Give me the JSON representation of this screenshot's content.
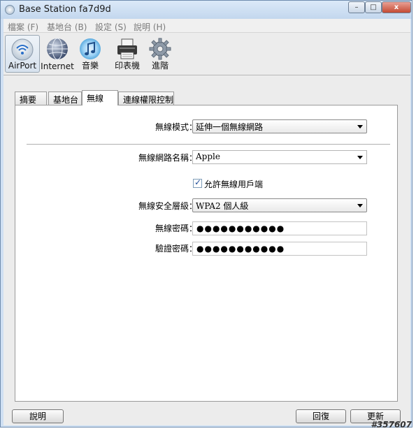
{
  "window": {
    "title": "Base Station fa7d9d"
  },
  "window_controls": {
    "minimize": "–",
    "maximize": "□",
    "close": "x"
  },
  "menu": [
    "檔案 (F)",
    "基地台 (B)",
    "設定 (S)",
    "說明 (H)"
  ],
  "toolbar": [
    {
      "label": "AirPort",
      "icon": "airport-icon",
      "selected": true
    },
    {
      "label": "Internet",
      "icon": "globe-icon",
      "selected": false
    },
    {
      "label": "音樂",
      "icon": "music-icon",
      "selected": false
    },
    {
      "label": "印表機",
      "icon": "printer-icon",
      "selected": false
    },
    {
      "label": "進階",
      "icon": "gear-icon",
      "selected": false
    }
  ],
  "tabs": [
    {
      "label": "摘要",
      "active": false
    },
    {
      "label": "基地台",
      "active": false
    },
    {
      "label": "無線",
      "active": true
    },
    {
      "label": "連線權限控制",
      "active": false
    }
  ],
  "form": {
    "wireless_mode_label": "無線模式：",
    "wireless_mode_value": "延伸一個無線網路",
    "network_name_label": "無線網路名稱：",
    "network_name_value": "Apple",
    "allow_clients_label": "允許無線用戶端",
    "allow_clients_checked": true,
    "security_label": "無線安全層級：",
    "security_value": "WPA2 個人級",
    "password_label": "無線密碼：",
    "password_value": "●●●●●●●●●●●",
    "verify_label": "驗證密碼：",
    "verify_value": "●●●●●●●●●●●"
  },
  "buttons": {
    "help": "說明",
    "revert": "回復",
    "update": "更新"
  },
  "watermark": "#357607",
  "colors": {
    "chrome": "#cfe0f3",
    "panel": "#ffffff",
    "close": "#c44a33"
  }
}
